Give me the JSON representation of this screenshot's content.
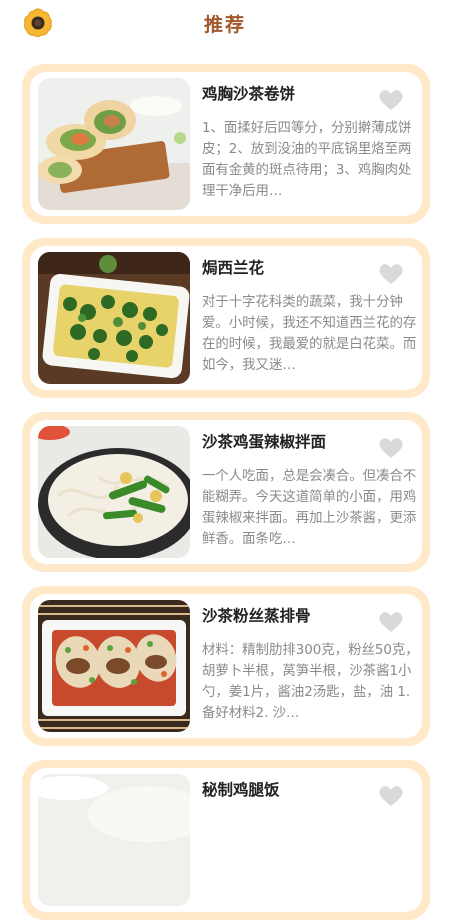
{
  "header": {
    "title": "推荐",
    "logo_icon": "cookie-icon"
  },
  "recipes": [
    {
      "title": "鸡胸沙茶卷饼",
      "desc": "1、面揉好后四等分，分别擀薄成饼皮；2、放到没油的平底锅里烙至两面有金黄的斑点待用；3、鸡胸肉处理干净后用…"
    },
    {
      "title": "焗西兰花",
      "desc": "对于十字花科类的蔬菜，我十分钟爱。小时候，我还不知道西兰花的存在的时候，我最爱的就是白花菜。而如今，我又迷…"
    },
    {
      "title": "沙茶鸡蛋辣椒拌面",
      "desc": "一个人吃面，总是会凑合。但凑合不能糊弄。今天这道简单的小面，用鸡蛋辣椒来拌面。再加上沙茶酱，更添鲜香。面条吃…"
    },
    {
      "title": "沙茶粉丝蒸排骨",
      "desc": "材料：精制肋排300克，粉丝50克，胡萝卜半根，莴笋半根，沙茶酱1小勺，姜1片，酱油2汤匙，盐，油 1. 备好材料2. 沙…"
    },
    {
      "title": "秘制鸡腿饭",
      "desc": ""
    }
  ],
  "colors": {
    "accent": "#a0582a",
    "card_border": "#ffe9c8",
    "heart": "#d9d9d9"
  }
}
